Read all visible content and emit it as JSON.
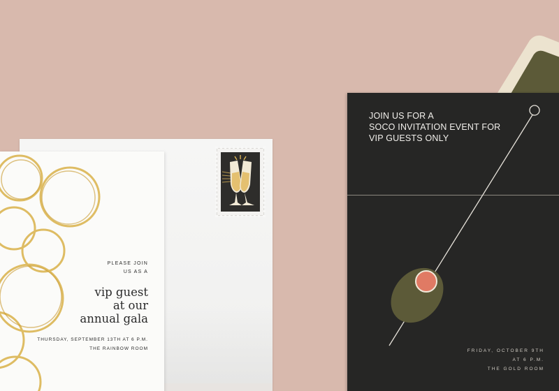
{
  "white_card": {
    "please_join": "PLEASE JOIN",
    "us_as_a": "US AS A",
    "gala_line1": "vip guest",
    "gala_line2": "at our",
    "gala_line3": "annual gala",
    "date_line": "THURSDAY, SEPTEMBER 13TH AT 6 P.M.",
    "venue_line": "THE RAINBOW ROOM"
  },
  "black_card": {
    "headline_line1": "JOIN US FOR A",
    "headline_line2": "SOCO INVITATION EVENT FOR",
    "headline_line3": "VIP GUESTS ONLY",
    "date_line1": "FRIDAY, OCTOBER 9TH",
    "date_line2": "AT 6 P.M.",
    "venue_line": "THE GOLD ROOM"
  },
  "colors": {
    "background": "#d8b9ad",
    "gold": "#d9b24a",
    "black_card": "#262625",
    "olive": "#5c5a38",
    "pimento": "#e07a64"
  },
  "icons": {
    "stamp": "champagne-toast-stamp",
    "cocktail": "martini-olive-pick"
  }
}
